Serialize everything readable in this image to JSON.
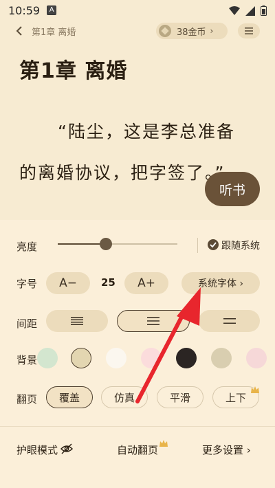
{
  "status": {
    "time": "10:59",
    "a_badge": "A"
  },
  "reader": {
    "breadcrumb": "第1章  离婚",
    "coins": "38金币",
    "coin_chevron": "›"
  },
  "content": {
    "chapter_title": "第1章  离婚",
    "line1": "“陆尘，这是李总准备",
    "line2": "的离婚协议，把字签了。”",
    "listen_label": "听书"
  },
  "settings": {
    "brightness_label": "亮度",
    "brightness_level": 0.4,
    "follow_system": "跟随系统",
    "fontsize_label": "字号",
    "font_decrease": "A−",
    "font_size_value": "25",
    "font_increase": "A+",
    "system_font": "系统字体 ›",
    "spacing_label": "间距",
    "background_label": "背景",
    "background_colors": [
      "#d3e6cf",
      "#e3d6b1",
      "#fbf7ef",
      "#fbdcdc",
      "#2b2523",
      "#d9ceb0",
      "#f6d8d8"
    ],
    "pageturn_label": "翻页",
    "pageturn_options": [
      "覆盖",
      "仿真",
      "平滑",
      "上下"
    ]
  },
  "bottom": {
    "eye_mode": "护眼模式",
    "auto_page": "自动翻页",
    "more_settings": "更多设置 ›"
  }
}
